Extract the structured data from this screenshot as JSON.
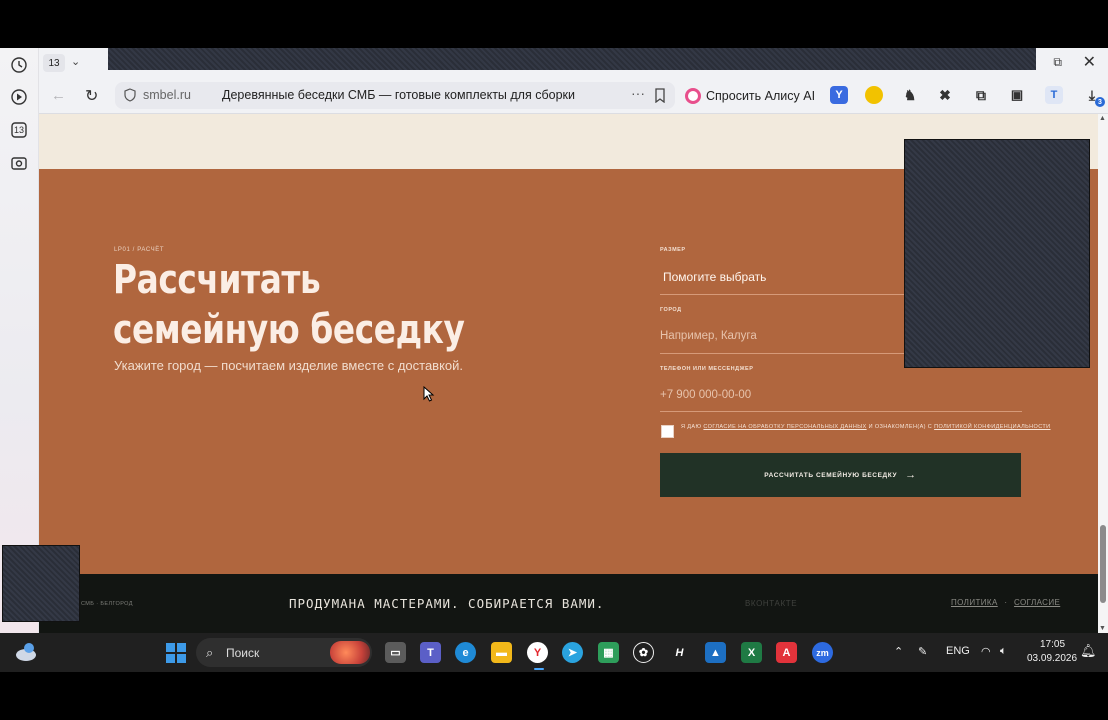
{
  "browser": {
    "tab_count": "13",
    "sidepanel_badge": "13",
    "address": {
      "domain": "smbel.ru",
      "title": "Деревянные беседки СМБ — готовые комплекты для сборки"
    },
    "alice_label": "Спросить Алису AI",
    "extension_badge": "3"
  },
  "page": {
    "breadcrumb": "LP01 / РАСЧЁТ",
    "title": "Рассчитать семейную беседку",
    "subtitle": "Укажите город — посчитаем изделие вместе с доставкой.",
    "form": {
      "size_label": "Размер",
      "size_value": "Помогите выбрать",
      "city_label": "Город",
      "city_placeholder": "Например, Калуга",
      "phone_label": "Телефон или мессенджер",
      "phone_placeholder": "+7 900 000-00-00",
      "consent_prefix": "Я даю",
      "consent_link1": "согласие на обработку персональных данных",
      "consent_middle": "и ознакомлен(а) с",
      "consent_link2": "политикой конфиденциальности",
      "submit_label": "Рассчитать семейную беседку"
    },
    "footer": {
      "location": "СМБ · Белгород",
      "slogan": "ПРОДУМАНА МАСТЕРАМИ. СОБИРАЕТСЯ ВАМИ.",
      "vk": "ВКОНТАКТЕ",
      "policy": "ПОЛИТИКА",
      "separator": "·",
      "consent": "СОГЛАСИЕ"
    }
  },
  "taskbar": {
    "search_label": "Поиск",
    "lang": "ENG",
    "time": "17:05",
    "date": "03.09.2026"
  },
  "colors": {
    "hero_bg": "#b0663e",
    "page_top_bg": "#f2eadd",
    "submit_bg": "#213226",
    "footer_bg": "#121512"
  }
}
